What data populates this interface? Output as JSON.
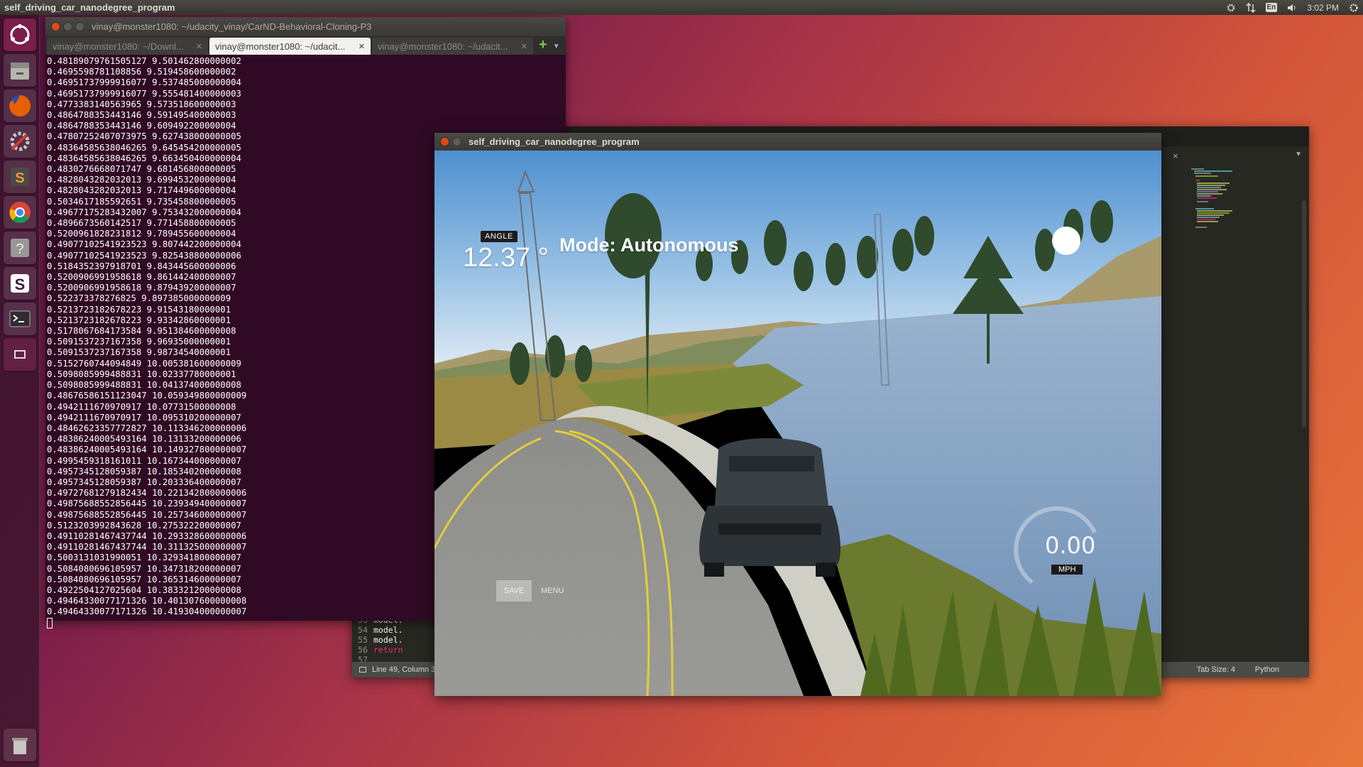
{
  "top_panel": {
    "title": "self_driving_car_nanodegree_program",
    "lang": "En",
    "time": "3:02 PM",
    "icons": [
      "settings-tray-icon",
      "network-icon",
      "keyboard-lang-icon",
      "volume-icon",
      "power-gear-icon"
    ]
  },
  "launcher": {
    "items": [
      {
        "name": "dash-icon",
        "color": "#7a1e4a"
      },
      {
        "name": "files-icon",
        "color": "#8a8a86"
      },
      {
        "name": "firefox-icon",
        "color": "#e66000"
      },
      {
        "name": "settings-icon",
        "color": "#d13b2e"
      },
      {
        "name": "sublime-text-icon",
        "color": "#4a4a4a"
      },
      {
        "name": "chrome-icon",
        "color": "#4285f4"
      },
      {
        "name": "help-icon",
        "color": "#8a8a86"
      },
      {
        "name": "slack-icon",
        "color": "#e01e5a"
      },
      {
        "name": "terminal-icon",
        "color": "#2e2e2e"
      },
      {
        "name": "window-icon",
        "color": "#6e2a4e"
      },
      {
        "name": "trash-icon",
        "color": "#8a8a86"
      }
    ]
  },
  "terminal": {
    "title": "vinay@monster1080: ~/udacity_vinay/CarND-Behavioral-Cloning-P3",
    "tabs": [
      {
        "label": "vinay@monster1080: ~/Downl..."
      },
      {
        "label": "vinay@monster1080: ~/udacit..."
      },
      {
        "label": "vinay@monster1080: ~/udacit..."
      }
    ],
    "lines": [
      "0.48189079761505127 9.501462800000002",
      "0.4695598781108856 9.519458600000002",
      "0.46951737999916077 9.537485000000004",
      "0.46951737999916077 9.555481400000003",
      "0.4773383140563965 9.573518600000003",
      "0.4864788353443146 9.591495400000003",
      "0.4864788353443146 9.609492200000004",
      "0.47807252407073975 9.627438000000005",
      "0.48364585638046265 9.645454200000005",
      "0.48364585638046265 9.663450400000004",
      "0.4830276668071747 9.681456800000005",
      "0.4828043282032013 9.699453200000004",
      "0.4828043282032013 9.717449600000004",
      "0.5034617185592651 9.735458800000005",
      "0.49677175283432007 9.753432000000004",
      "0.4896673560142517 9.771458800000005",
      "0.5200961828231812 9.789455600000004",
      "0.49077102541923523 9.807442200000004",
      "0.49077102541923523 9.825438800000006",
      "0.5184352397918701 9.843445600000006",
      "0.5200906991958618 9.861442400000007",
      "0.5200906991958618 9.879439200000007",
      "0.522373378276825 9.897385000000009",
      "0.5213723182678223 9.91543180000001",
      "0.5213723182678223 9.93342860000001",
      "0.5178067684173584 9.951384600000008",
      "0.5091537237167358 9.96935000000001",
      "0.5091537237167358 9.98734540000001",
      "0.5152760744094849 10.005381600000009",
      "0.5098085999488831 10.02337780000001",
      "0.5098085999488831 10.041374000000008",
      "0.48676586151123047 10.059349800000009",
      "0.4942111670970917 10.07731500000008",
      "0.4942111670970917 10.095310200000007",
      "0.48462623357772827 10.113346200000006",
      "0.48386240005493164 10.13133200000006",
      "0.48386240005493164 10.149327800000007",
      "0.4995459318161011 10.167344000000007",
      "0.4957345128059387 10.185340200000008",
      "0.4957345128059387 10.203336400000007",
      "0.49727681279182434 10.221342800000006",
      "0.49875688552856445 10.239349400000007",
      "0.49875688552856445 10.257346000000007",
      "0.5123203992843628 10.275322200000007",
      "0.49110281467437744 10.293328600000006",
      "0.49110281467437744 10.311325000000007",
      "0.5003131031990051 10.329341800000007",
      "0.5084080696105957 10.347318200000007",
      "0.5084080696105957 10.365314600000007",
      "0.4922504127025604 10.383321200000008",
      "0.49464330077171326 10.401307600000008",
      "0.49464330077171326 10.419304000000007"
    ]
  },
  "editor": {
    "code": [
      {
        "num": "53",
        "text": "model.",
        "kw": false
      },
      {
        "num": "54",
        "text": "model.",
        "kw": false
      },
      {
        "num": "55",
        "text": "model.",
        "kw": false
      },
      {
        "num": "56",
        "text": "return",
        "kw": true
      },
      {
        "num": "57",
        "text": "",
        "kw": false
      }
    ],
    "status_position": "Line 49, Column 3",
    "tab_size": "Tab Size: 4",
    "syntax": "Python",
    "close_glyph": "×",
    "dropdown_glyph": "▼"
  },
  "simulator": {
    "title": "self_driving_car_nanodegree_program",
    "angle_label": "ANGLE",
    "angle_value": "12.37 °",
    "mode": "Mode: Autonomous",
    "speed": "0.00",
    "speed_unit": "MPH",
    "save_label": "SAVE",
    "menu_label": "MENU",
    "speed_fraction": 0.0
  }
}
